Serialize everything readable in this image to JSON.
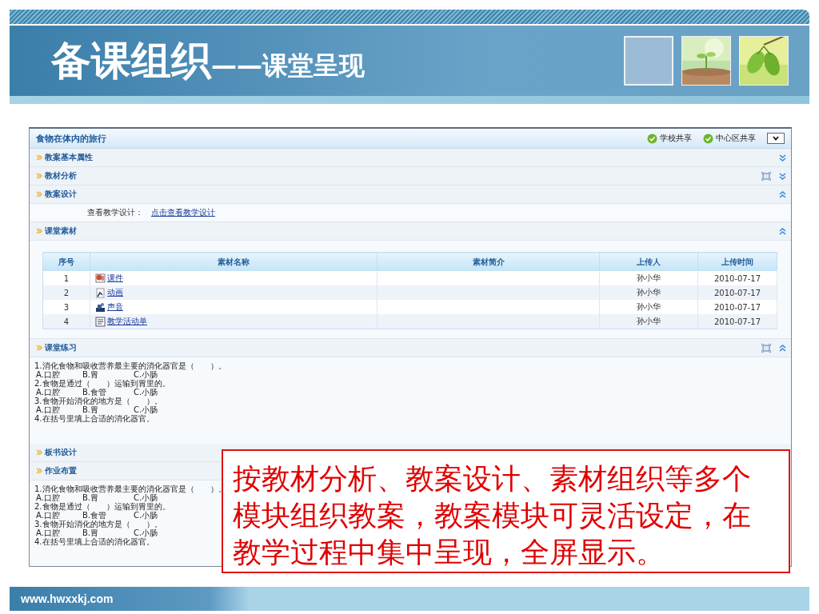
{
  "header": {
    "title": "备课组织",
    "subtitle": "——课堂呈现"
  },
  "panel": {
    "title": "食物在体内的旅行",
    "shares": [
      {
        "label": "学校共享",
        "checked": true
      },
      {
        "label": "中心区共享",
        "checked": true
      }
    ],
    "sections": [
      {
        "title": "教案基本属性",
        "expanded": false,
        "fullscreen": false
      },
      {
        "title": "教材分析",
        "expanded": false,
        "fullscreen": true
      },
      {
        "title": "教案设计",
        "expanded": true,
        "fullscreen": false,
        "content": {
          "kind": "link",
          "label": "查看教学设计：",
          "link": "点击查看教学设计"
        }
      },
      {
        "title": "课堂素材",
        "expanded": true,
        "fullscreen": false,
        "content": {
          "kind": "table",
          "columns": [
            "序号",
            "素材名称",
            "素材简介",
            "上传人",
            "上传时间"
          ],
          "rows": [
            {
              "number": "1",
              "name": "课件",
              "kind": "slides",
              "uploader": "孙小华",
              "date": "2010-07-17"
            },
            {
              "number": "2",
              "name": "动画",
              "kind": "animation",
              "uploader": "孙小华",
              "date": "2010-07-17"
            },
            {
              "number": "3",
              "name": "声音",
              "kind": "sound",
              "uploader": "孙小华",
              "date": "2010-07-17"
            },
            {
              "number": "4",
              "name": "教学活动单",
              "kind": "document",
              "uploader": "孙小华",
              "date": "2010-07-17"
            }
          ]
        }
      },
      {
        "title": "课堂练习",
        "expanded": true,
        "fullscreen": true,
        "content": {
          "kind": "exercise",
          "lines": [
            {
              "kind": "question",
              "text": "1.消化食物和吸收营养最主要的消化器官是（　　）。"
            },
            {
              "kind": "options",
              "options": [
                "A.口腔",
                "B.胃",
                "C.小肠"
              ]
            },
            {
              "kind": "question",
              "text": "2.食物是通过（　　）运输到胃里的。"
            },
            {
              "kind": "options",
              "options": [
                "A.口腔",
                "B.食管",
                "C.小肠"
              ]
            },
            {
              "kind": "question",
              "text": "3.食物开始消化的地方是（　　）。"
            },
            {
              "kind": "options",
              "options": [
                "A.口腔",
                "B.胃",
                "C.小肠"
              ]
            },
            {
              "kind": "question",
              "text": "4.在括号里填上合适的消化器官。"
            }
          ]
        }
      },
      {
        "title": "板书设计"
      },
      {
        "title": "作业布置",
        "content": {
          "kind": "exercise",
          "lines": [
            {
              "kind": "question",
              "text": "1.消化食物和吸收营养最主要的消化器官是（　　）。"
            },
            {
              "kind": "options",
              "options": [
                "A.口腔",
                "B.胃",
                "C.小肠"
              ]
            },
            {
              "kind": "question",
              "text": "2.食物是通过（　　）运输到胃里的。"
            },
            {
              "kind": "options",
              "options": [
                "A.口腔",
                "B.食管",
                "C.小肠"
              ]
            },
            {
              "kind": "question",
              "text": "3.食物开始消化的地方是（　　）。"
            },
            {
              "kind": "options",
              "options": [
                "A.口腔",
                "B.胃",
                "C.小肠"
              ]
            },
            {
              "kind": "question",
              "text": "4.在括号里填上合适的消化器官。"
            }
          ]
        }
      }
    ]
  },
  "callout": {
    "text": "按教材分析、教案设计、素材组织等多个模块组织教案，教案模块可灵活设定，在教学过程中集中呈现，全屏显示。"
  },
  "footer": {
    "url": "www.hwxxkj.com"
  }
}
